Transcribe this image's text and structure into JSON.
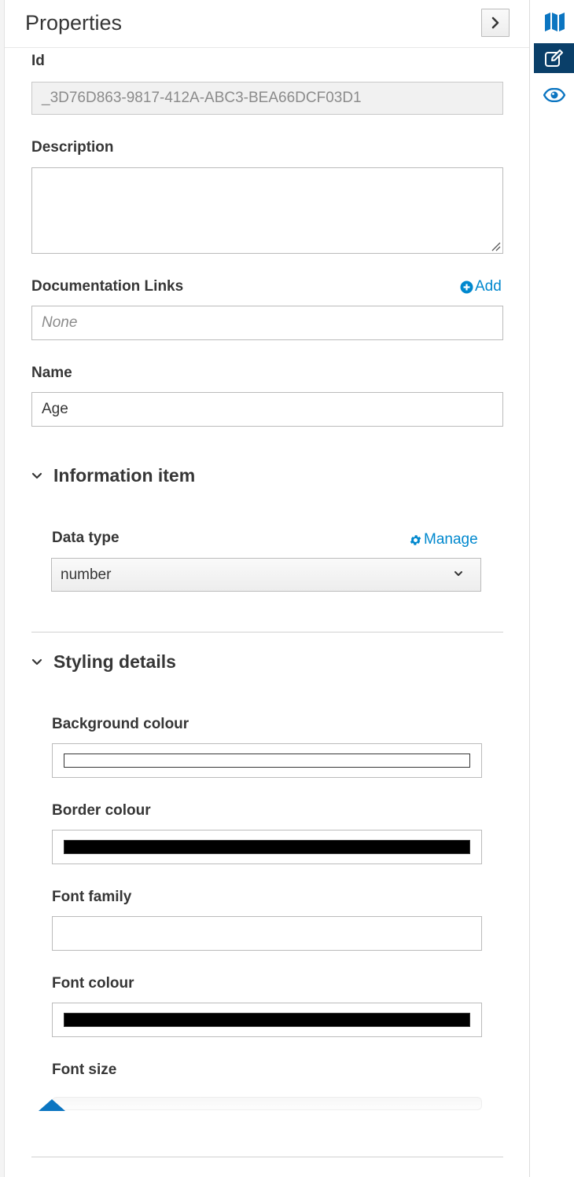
{
  "panel": {
    "title": "Properties"
  },
  "fields": {
    "id": {
      "label": "Id",
      "value": "_3D76D863-9817-412A-ABC3-BEA66DCF03D1"
    },
    "description": {
      "label": "Description",
      "value": ""
    },
    "documentation_links": {
      "label": "Documentation Links",
      "add_label": "Add",
      "placeholder": "None"
    },
    "name": {
      "label": "Name",
      "value": "Age"
    }
  },
  "information_item": {
    "title": "Information item",
    "data_type": {
      "label": "Data type",
      "manage_label": "Manage",
      "selected": "number"
    }
  },
  "styling_details": {
    "title": "Styling details",
    "background_colour": {
      "label": "Background colour",
      "color": "#ffffff"
    },
    "border_colour": {
      "label": "Border colour",
      "color": "#000000"
    },
    "font_family": {
      "label": "Font family",
      "value": ""
    },
    "font_colour": {
      "label": "Font colour",
      "color": "#000000"
    },
    "font_size": {
      "label": "Font size",
      "level": 0
    }
  },
  "rail": {
    "items": [
      {
        "icon": "map-icon",
        "active": false
      },
      {
        "icon": "edit-icon",
        "active": true
      },
      {
        "icon": "eye-icon",
        "active": false
      }
    ]
  },
  "colors": {
    "accent": "#0088ce",
    "rail_active": "#0a3f69",
    "slider_thumb": "#0b75c1"
  }
}
